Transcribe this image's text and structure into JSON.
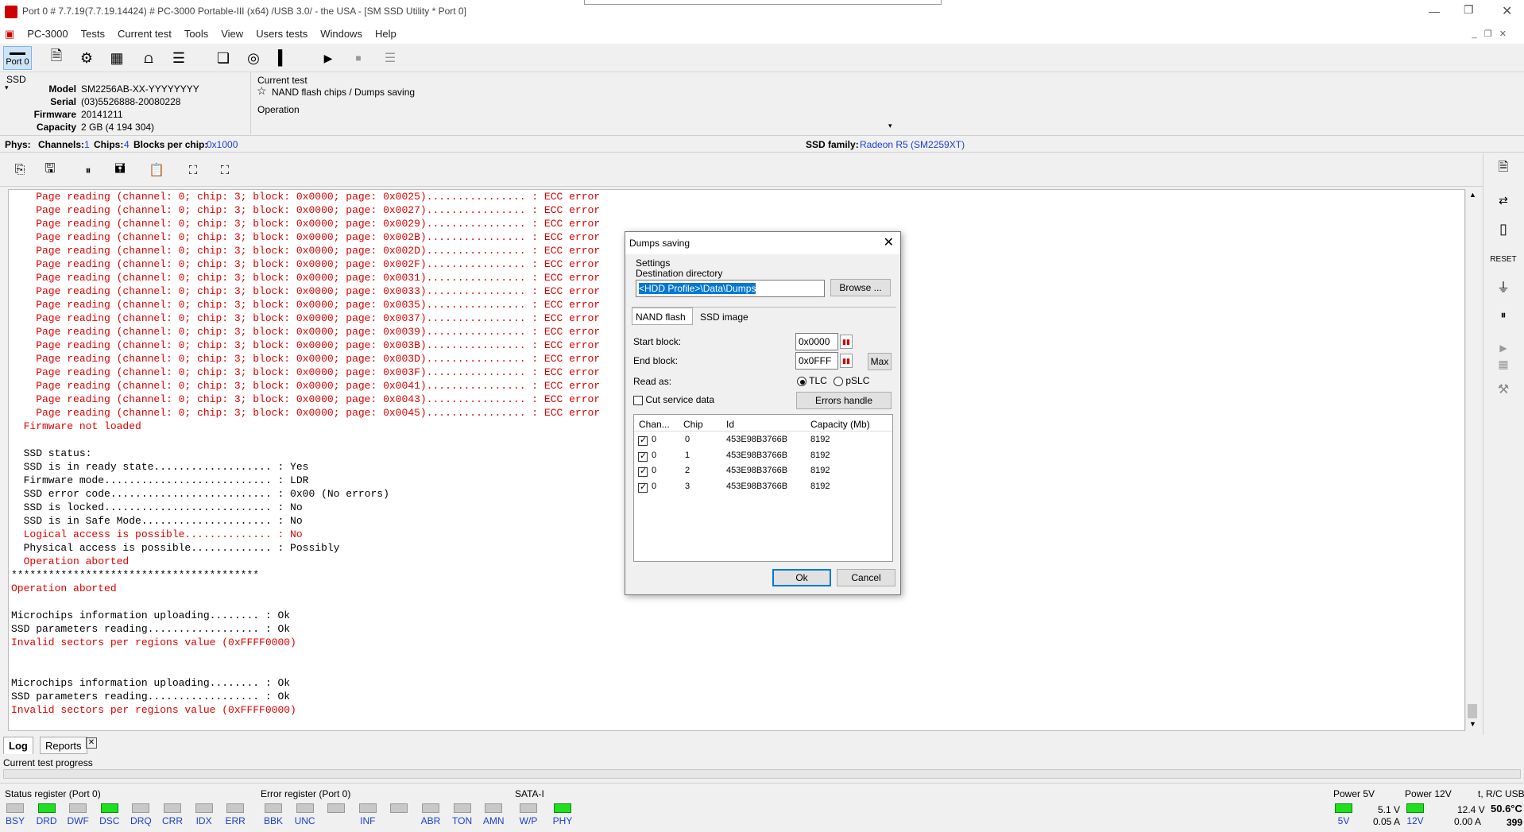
{
  "window": {
    "title": "Port 0 # 7.7.19(7.7.19.14424) # PC-3000 Portable-III (x64) /USB 3.0/ - the USA - [SM SSD Utility * Port 0]"
  },
  "menu": [
    "PC-3000",
    "Tests",
    "Current test",
    "Tools",
    "View",
    "Users tests",
    "Windows",
    "Help"
  ],
  "toolbar": {
    "port_label": "Port 0"
  },
  "ssd": {
    "header": "SSD",
    "fields": [
      {
        "label": "Model",
        "value": "SM2256AB-XX-YYYYYYYY"
      },
      {
        "label": "Serial",
        "value": "(03)5526888-20080228"
      },
      {
        "label": "Firmware",
        "value": "20141211"
      },
      {
        "label": "Capacity",
        "value": "2 GB (4 194 304)"
      }
    ]
  },
  "current_test": {
    "label": "Current test",
    "name": "NAND flash chips / Dumps saving",
    "operation_label": "Operation"
  },
  "phys": {
    "label": "Phys:",
    "channels_label": "Channels:",
    "channels": "1",
    "chips_label": "Chips:",
    "chips": "4",
    "blocks_label": "Blocks per chip:",
    "blocks": "0x1000",
    "family_label": "SSD family:",
    "family": "Radeon R5 (SM2259XT)"
  },
  "log_lines": [
    {
      "t": "    Page reading (channel: 0; chip: 3; block: 0x0000; page: 0x0025)................ : ECC error",
      "c": "red"
    },
    {
      "t": "    Page reading (channel: 0; chip: 3; block: 0x0000; page: 0x0027)................ : ECC error",
      "c": "red"
    },
    {
      "t": "    Page reading (channel: 0; chip: 3; block: 0x0000; page: 0x0029)................ : ECC error",
      "c": "red"
    },
    {
      "t": "    Page reading (channel: 0; chip: 3; block: 0x0000; page: 0x002B)................ : ECC error",
      "c": "red"
    },
    {
      "t": "    Page reading (channel: 0; chip: 3; block: 0x0000; page: 0x002D)................ : ECC error",
      "c": "red"
    },
    {
      "t": "    Page reading (channel: 0; chip: 3; block: 0x0000; page: 0x002F)................ : ECC error",
      "c": "red"
    },
    {
      "t": "    Page reading (channel: 0; chip: 3; block: 0x0000; page: 0x0031)................ : ECC error",
      "c": "red"
    },
    {
      "t": "    Page reading (channel: 0; chip: 3; block: 0x0000; page: 0x0033)................ : ECC error",
      "c": "red"
    },
    {
      "t": "    Page reading (channel: 0; chip: 3; block: 0x0000; page: 0x0035)................ : ECC error",
      "c": "red"
    },
    {
      "t": "    Page reading (channel: 0; chip: 3; block: 0x0000; page: 0x0037)................ : ECC error",
      "c": "red"
    },
    {
      "t": "    Page reading (channel: 0; chip: 3; block: 0x0000; page: 0x0039)................ : ECC error",
      "c": "red"
    },
    {
      "t": "    Page reading (channel: 0; chip: 3; block: 0x0000; page: 0x003B)................ : ECC error",
      "c": "red"
    },
    {
      "t": "    Page reading (channel: 0; chip: 3; block: 0x0000; page: 0x003D)................ : ECC error",
      "c": "red"
    },
    {
      "t": "    Page reading (channel: 0; chip: 3; block: 0x0000; page: 0x003F)................ : ECC error",
      "c": "red"
    },
    {
      "t": "    Page reading (channel: 0; chip: 3; block: 0x0000; page: 0x0041)................ : ECC error",
      "c": "red"
    },
    {
      "t": "    Page reading (channel: 0; chip: 3; block: 0x0000; page: 0x0043)................ : ECC error",
      "c": "red"
    },
    {
      "t": "    Page reading (channel: 0; chip: 3; block: 0x0000; page: 0x0045)................ : ECC error",
      "c": "red"
    },
    {
      "t": "  Firmware not loaded",
      "c": "red"
    },
    {
      "t": "",
      "c": "blk"
    },
    {
      "t": "  SSD status:",
      "c": "blk"
    },
    {
      "t": "  SSD is in ready state................... : Yes",
      "c": "blk"
    },
    {
      "t": "  Firmware mode........................... : LDR",
      "c": "blk"
    },
    {
      "t": "  SSD error code.......................... : 0x00 (No errors)",
      "c": "blk"
    },
    {
      "t": "  SSD is locked........................... : No",
      "c": "blk"
    },
    {
      "t": "  SSD is in Safe Mode..................... : No",
      "c": "blk"
    },
    {
      "t": "  Logical access is possible.............. : No",
      "c": "red"
    },
    {
      "t": "  Physical access is possible............. : Possibly",
      "c": "blk"
    },
    {
      "t": "  Operation aborted",
      "c": "red"
    },
    {
      "t": "****************************************",
      "c": "blk"
    },
    {
      "t": "Operation aborted",
      "c": "red"
    },
    {
      "t": "",
      "c": "blk"
    },
    {
      "t": "Microchips information uploading........ : Ok",
      "c": "blk"
    },
    {
      "t": "SSD parameters reading.................. : Ok",
      "c": "blk"
    },
    {
      "t": "Invalid sectors per regions value (0xFFFF0000)",
      "c": "red"
    },
    {
      "t": "",
      "c": "blk"
    },
    {
      "t": "",
      "c": "blk"
    },
    {
      "t": "Microchips information uploading........ : Ok",
      "c": "blk"
    },
    {
      "t": "SSD parameters reading.................. : Ok",
      "c": "blk"
    },
    {
      "t": "Invalid sectors per regions value (0xFFFF0000)",
      "c": "red"
    }
  ],
  "tabs": {
    "log": "Log",
    "reports": "Reports"
  },
  "progress_label": "Current test progress",
  "status_register": {
    "title": "Status register (Port 0)",
    "flags": [
      {
        "name": "BSY",
        "on": false
      },
      {
        "name": "DRD",
        "on": true
      },
      {
        "name": "DWF",
        "on": false
      },
      {
        "name": "DSC",
        "on": true
      },
      {
        "name": "DRQ",
        "on": false
      },
      {
        "name": "CRR",
        "on": false
      },
      {
        "name": "IDX",
        "on": false
      },
      {
        "name": "ERR",
        "on": false
      }
    ]
  },
  "error_register": {
    "title": "Error register (Port 0)",
    "flags": [
      "BBK",
      "UNC",
      "",
      "INF",
      "",
      "ABR",
      "TON",
      "AMN"
    ]
  },
  "sata": {
    "title": "SATA-I",
    "flags": [
      {
        "name": "W/P",
        "on": false
      },
      {
        "name": "PHY",
        "on": true
      }
    ]
  },
  "power5": {
    "title": "Power 5V",
    "volt": "5.1 V",
    "amp": "0.05 A",
    "led_label": "5V"
  },
  "power12": {
    "title": "Power 12V",
    "volt": "12.4 V",
    "amp": "0.00 A",
    "led_label": "12V"
  },
  "temp": {
    "title": "t, R/C USB",
    "value": "50.6°C",
    "count": "399"
  },
  "dialog": {
    "title": "Dumps saving",
    "settings_label": "Settings",
    "dest_label": "Destination directory",
    "dest_value": "<HDD Profile>\\Data\\Dumps",
    "browse": "Browse ...",
    "tab_nand": "NAND flash",
    "tab_ssd": "SSD image",
    "start_label": "Start block:",
    "start_value": "0x0000",
    "end_label": "End block:",
    "end_value": "0x0FFF",
    "max": "Max",
    "read_as": "Read as:",
    "tlc": "TLC",
    "pslc": "pSLC",
    "cut_service": "Cut service data",
    "errors_handle": "Errors handle",
    "columns": [
      "Chan...",
      "Chip",
      "Id",
      "Capacity (Mb)"
    ],
    "rows": [
      {
        "chan": "0",
        "chip": "0",
        "id": "453E98B3766B",
        "cap": "8192"
      },
      {
        "chan": "0",
        "chip": "1",
        "id": "453E98B3766B",
        "cap": "8192"
      },
      {
        "chan": "0",
        "chip": "2",
        "id": "453E98B3766B",
        "cap": "8192"
      },
      {
        "chan": "0",
        "chip": "3",
        "id": "453E98B3766B",
        "cap": "8192"
      }
    ],
    "ok": "Ok",
    "cancel": "Cancel"
  }
}
